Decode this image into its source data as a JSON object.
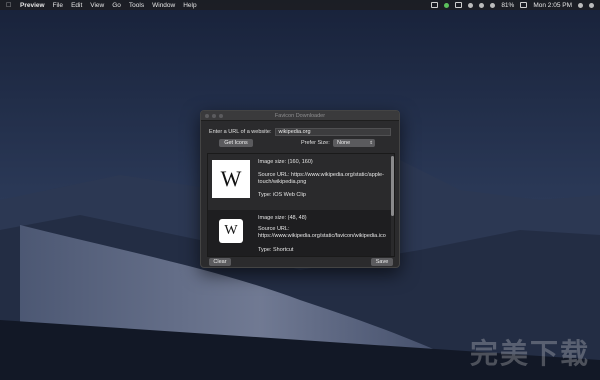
{
  "menubar": {
    "app_name": "Preview",
    "items": [
      "File",
      "Edit",
      "View",
      "Go",
      "Tools",
      "Window",
      "Help"
    ],
    "battery": "81%",
    "clock": "Mon 2:05 PM"
  },
  "window": {
    "title": "Favicon Downloader",
    "url_label": "Enter a URL of a website:",
    "url_value": "wikipedia.org",
    "get_icons_label": "Get Icons",
    "prefer_size_label": "Prefer Size:",
    "prefer_size_value": "None",
    "clear_label": "Clear",
    "save_label": "Save"
  },
  "results": [
    {
      "size": "Image size: (160, 160)",
      "source": "Source URL: https://www.wikipedia.org/static/apple-touch/wikipedia.png",
      "type": "Type: iOS Web Clip",
      "glyph": "W"
    },
    {
      "size": "Image size: (48, 48)",
      "source": "Source URL: https://www.wikipedia.org/static/favicon/wikipedia.ico",
      "type": "Type: Shortcut",
      "glyph": "W"
    }
  ],
  "watermark": "完美下载",
  "colors": {
    "window_bg": "#2b2b2d",
    "button_bg": "#5b5b5e",
    "selection_row": "#2a2a2c"
  }
}
